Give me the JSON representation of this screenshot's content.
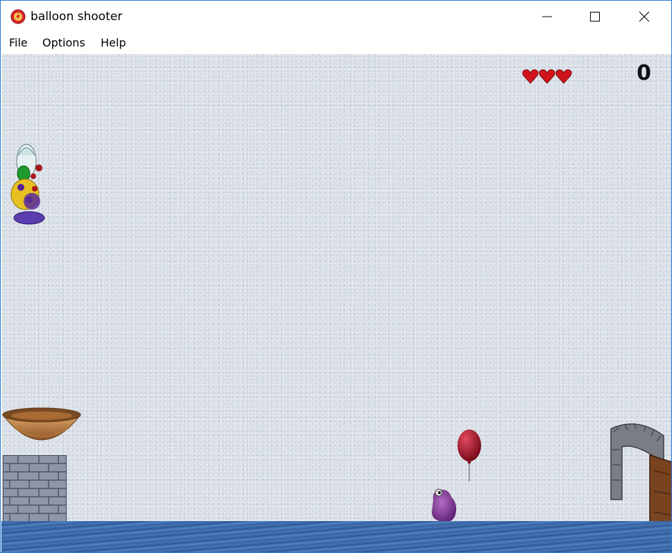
{
  "window": {
    "title": "balloon shooter",
    "controls": {
      "minimize_icon": "minimize-icon",
      "maximize_icon": "maximize-icon",
      "close_icon": "close-icon"
    }
  },
  "menu": {
    "items": [
      {
        "label": "File"
      },
      {
        "label": "Options"
      },
      {
        "label": "Help"
      }
    ]
  },
  "game": {
    "score": "0",
    "lives": 3,
    "colors": {
      "background": "#d9dfe7",
      "water": "#3f6dae",
      "heart": "#d0141c",
      "balloon": "#a3122a",
      "blob": "#8a3a9c"
    },
    "sprites": [
      "clown-character-icon",
      "wooden-bowl-icon",
      "brick-tower-icon",
      "red-balloon-icon",
      "purple-blob-creature-icon",
      "stone-arch-door-icon"
    ]
  }
}
